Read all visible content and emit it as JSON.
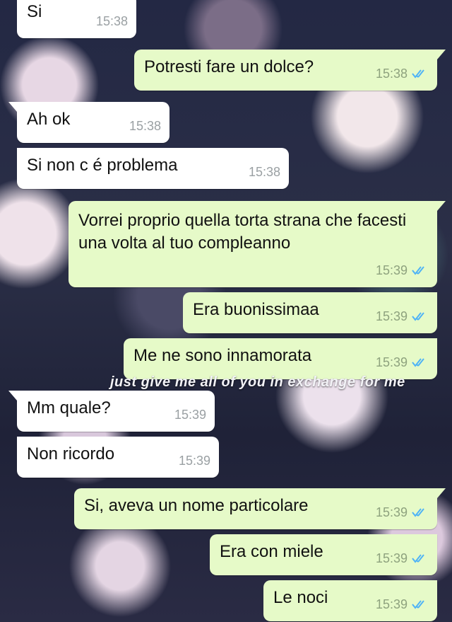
{
  "colors": {
    "incoming": "#ffffff",
    "outgoing": "#e6fac8",
    "read_ticks": "#4fb3f6"
  },
  "overlay_text": "just give me all of you in exchange for me",
  "messages": [
    {
      "direction": "in",
      "text": "Si",
      "time": "15:38"
    },
    {
      "direction": "out",
      "text": "Potresti fare un dolce?",
      "time": "15:38",
      "status": "read"
    },
    {
      "direction": "in",
      "text": "Ah ok",
      "time": "15:38"
    },
    {
      "direction": "in",
      "text": "Si non c é problema",
      "time": "15:38"
    },
    {
      "direction": "out",
      "text": "Vorrei proprio quella torta strana che facesti una volta al tuo compleanno",
      "time": "15:39",
      "status": "read"
    },
    {
      "direction": "out",
      "text": "Era buonissimaa",
      "time": "15:39",
      "status": "read"
    },
    {
      "direction": "out",
      "text": "Me ne sono innamorata",
      "time": "15:39",
      "status": "read"
    },
    {
      "direction": "in",
      "text": "Mm quale?",
      "time": "15:39"
    },
    {
      "direction": "in",
      "text": "Non ricordo",
      "time": "15:39"
    },
    {
      "direction": "out",
      "text": "Si, aveva un nome particolare",
      "time": "15:39",
      "status": "read"
    },
    {
      "direction": "out",
      "text": "Era con miele",
      "time": "15:39",
      "status": "read"
    },
    {
      "direction": "out",
      "text": "Le noci",
      "time": "15:39",
      "status": "read"
    }
  ]
}
